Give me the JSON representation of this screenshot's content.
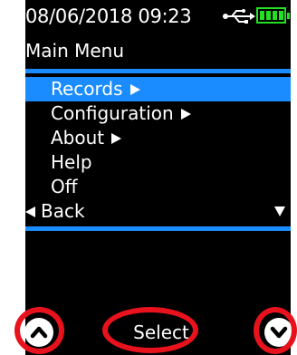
{
  "status_bar": {
    "datetime": "08/06/2018 09:23",
    "usb_icon": "usb-icon",
    "battery_icon": "battery-full-icon"
  },
  "menu": {
    "title": "Main Menu",
    "items": [
      {
        "label": "Records",
        "submenu": true,
        "selected": true
      },
      {
        "label": "Configuration",
        "submenu": true,
        "selected": false
      },
      {
        "label": "About",
        "submenu": true,
        "selected": false
      },
      {
        "label": "Help",
        "submenu": false,
        "selected": false
      },
      {
        "label": "Off",
        "submenu": false,
        "selected": false
      }
    ],
    "back_label": "Back",
    "more_indicator_icon": "triangle-down-icon"
  },
  "softkeys": {
    "left_icon": "chevron-up-icon",
    "center_label": "Select",
    "right_icon": "chevron-down-icon"
  },
  "colors": {
    "screen_background": "#000000",
    "accent": "#1a8cff",
    "battery": "#23e023",
    "annotation_highlight": "#e8121d",
    "text": "#ffffff"
  }
}
